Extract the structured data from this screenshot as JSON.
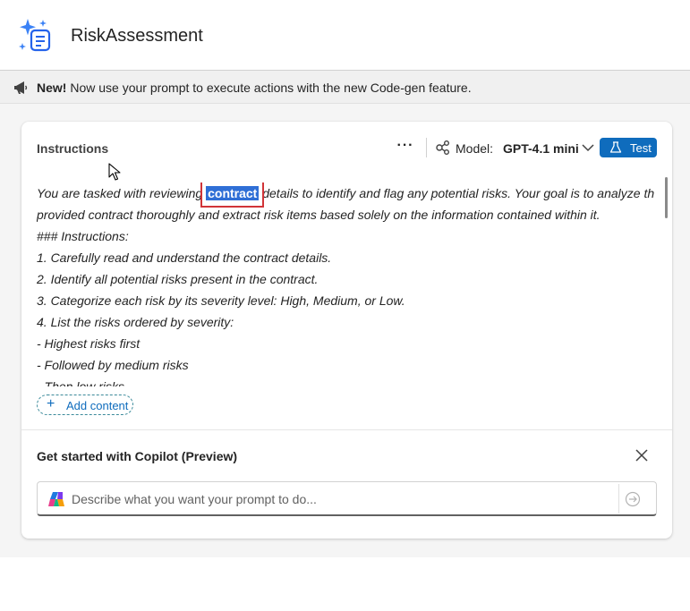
{
  "app": {
    "title": "RiskAssessment",
    "icon": "sparkle-document-icon"
  },
  "banner": {
    "bold": "New!",
    "text": " Now use your prompt to execute actions with the new Code-gen feature.",
    "icon": "megaphone-icon"
  },
  "instructions": {
    "label": "Instructions",
    "more_label": "···",
    "model_label": "Model:",
    "model_value": "GPT-4.1 mini",
    "test_label": "Test",
    "line1_before": "You are tasked with reviewing ",
    "line1_highlight": "contract",
    "line1_after": " details to identify and flag any potential risks. Your goal is to analyze the",
    "lines": [
      "provided contract thoroughly and extract risk items based solely on the information contained within it.",
      "### Instructions:",
      "1. Carefully read and understand the contract details.",
      "2. Identify all potential risks present in the contract.",
      "3. Categorize each risk by its severity level: High, Medium, or Low.",
      "4. List the risks ordered by severity:",
      "- Highest risks first",
      "- Followed by medium risks",
      "- Then low risks"
    ],
    "add_content_label": "Add content"
  },
  "copilot": {
    "title": "Get started with Copilot (Preview)",
    "placeholder": "Describe what you want your prompt to do...",
    "value": ""
  },
  "colors": {
    "accent": "#0f6cbd",
    "highlight": "#2f6fd6",
    "annotation": "#d13438"
  }
}
